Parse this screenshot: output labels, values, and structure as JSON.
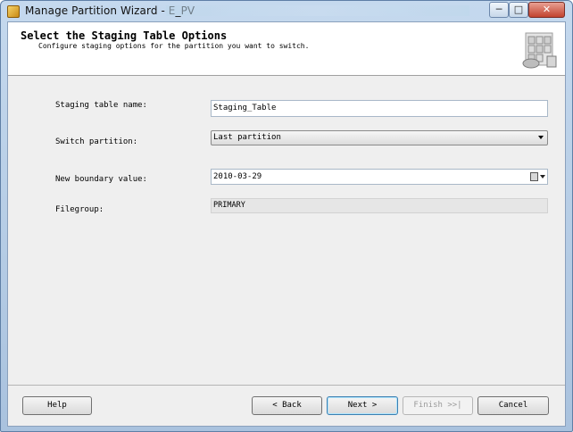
{
  "window": {
    "title": "Manage Partition Wizard - E_PV",
    "controls": {
      "minimize": "─",
      "maximize": "□",
      "close": "✕"
    }
  },
  "header": {
    "title": "Select the Staging Table Options",
    "subtitle": "Configure staging options for the partition you want to switch."
  },
  "form": {
    "staging_table_name": {
      "label": "Staging table name:",
      "value": "Staging_Table"
    },
    "switch_partition": {
      "label": "Switch partition:",
      "value": "Last partition"
    },
    "new_boundary_value": {
      "label": "New boundary value:",
      "value": "2010-03-29"
    },
    "filegroup": {
      "label": "Filegroup:",
      "value": "PRIMARY"
    }
  },
  "buttons": {
    "help": "Help",
    "back": "< Back",
    "next": "Next >",
    "finish": "Finish >>|",
    "cancel": "Cancel"
  },
  "icons": {
    "app": "wizard-app-icon",
    "calendar": "calendar-dropdown-icon",
    "header_art": "partition-storage-icon"
  },
  "colors": {
    "title_bar": "#b5cde6",
    "client_bg": "#efefef",
    "header_bg": "#ffffff",
    "close_button": "#c2432f"
  }
}
